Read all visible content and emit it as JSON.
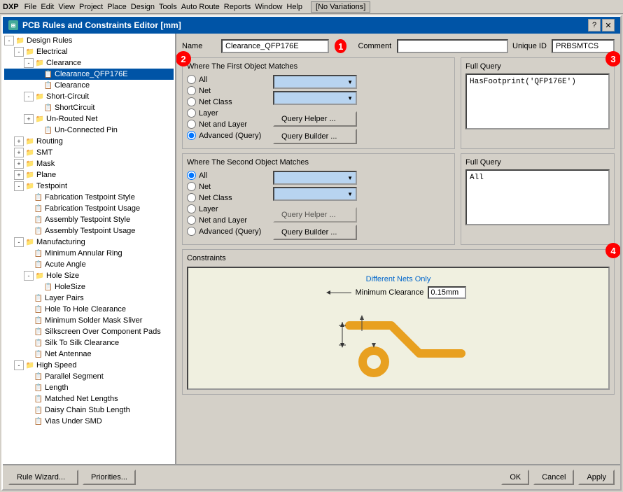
{
  "app": {
    "title": "PCB Rules and Constraints Editor [mm]",
    "help_btn": "?",
    "close_btn": "✕"
  },
  "menubar": {
    "items": [
      "DXP",
      "File",
      "Edit",
      "View",
      "Project",
      "Place",
      "Design",
      "Tools",
      "Auto Route",
      "Reports",
      "Window",
      "Help"
    ]
  },
  "topbar": {
    "variation": "[No Variations]"
  },
  "tree": {
    "root": "Design Rules",
    "items": [
      {
        "id": "design-rules",
        "label": "Design Rules",
        "level": 0,
        "expanded": true,
        "icon": "folder"
      },
      {
        "id": "electrical",
        "label": "Electrical",
        "level": 1,
        "expanded": true,
        "icon": "folder"
      },
      {
        "id": "clearance",
        "label": "Clearance",
        "level": 2,
        "expanded": true,
        "icon": "folder"
      },
      {
        "id": "clearance-qfp176e",
        "label": "Clearance_QFP176E",
        "level": 3,
        "expanded": false,
        "icon": "rule",
        "selected": true
      },
      {
        "id": "clearance-leaf",
        "label": "Clearance",
        "level": 3,
        "expanded": false,
        "icon": "rule"
      },
      {
        "id": "short-circuit",
        "label": "Short-Circuit",
        "level": 2,
        "expanded": true,
        "icon": "folder"
      },
      {
        "id": "shortcircuit-leaf",
        "label": "ShortCircuit",
        "level": 3,
        "expanded": false,
        "icon": "rule"
      },
      {
        "id": "un-routed-net",
        "label": "Un-Routed Net",
        "level": 2,
        "expanded": false,
        "icon": "folder"
      },
      {
        "id": "un-connected-pin",
        "label": "Un-Connected Pin",
        "level": 2,
        "expanded": false,
        "icon": "rule"
      },
      {
        "id": "routing",
        "label": "Routing",
        "level": 1,
        "expanded": false,
        "icon": "folder"
      },
      {
        "id": "smt",
        "label": "SMT",
        "level": 1,
        "expanded": false,
        "icon": "folder"
      },
      {
        "id": "mask",
        "label": "Mask",
        "level": 1,
        "expanded": false,
        "icon": "folder"
      },
      {
        "id": "plane",
        "label": "Plane",
        "level": 1,
        "expanded": false,
        "icon": "folder"
      },
      {
        "id": "testpoint",
        "label": "Testpoint",
        "level": 1,
        "expanded": true,
        "icon": "folder"
      },
      {
        "id": "fab-testpoint-style",
        "label": "Fabrication Testpoint Style",
        "level": 2,
        "expanded": false,
        "icon": "rule"
      },
      {
        "id": "fab-testpoint-usage",
        "label": "Fabrication Testpoint Usage",
        "level": 2,
        "expanded": false,
        "icon": "rule"
      },
      {
        "id": "asm-testpoint-style",
        "label": "Assembly Testpoint Style",
        "level": 2,
        "expanded": false,
        "icon": "rule"
      },
      {
        "id": "asm-testpoint-usage",
        "label": "Assembly Testpoint Usage",
        "level": 2,
        "expanded": false,
        "icon": "rule"
      },
      {
        "id": "manufacturing",
        "label": "Manufacturing",
        "level": 1,
        "expanded": true,
        "icon": "folder"
      },
      {
        "id": "min-annular-ring",
        "label": "Minimum Annular Ring",
        "level": 2,
        "expanded": false,
        "icon": "rule"
      },
      {
        "id": "acute-angle",
        "label": "Acute Angle",
        "level": 2,
        "expanded": false,
        "icon": "rule"
      },
      {
        "id": "hole-size",
        "label": "Hole Size",
        "level": 2,
        "expanded": true,
        "icon": "folder"
      },
      {
        "id": "holesize-leaf",
        "label": "HoleSize",
        "level": 3,
        "expanded": false,
        "icon": "rule"
      },
      {
        "id": "layer-pairs",
        "label": "Layer Pairs",
        "level": 2,
        "expanded": false,
        "icon": "rule"
      },
      {
        "id": "hole-to-hole",
        "label": "Hole To Hole Clearance",
        "level": 2,
        "expanded": false,
        "icon": "rule"
      },
      {
        "id": "min-solder-mask",
        "label": "Minimum Solder Mask Sliver",
        "level": 2,
        "expanded": false,
        "icon": "rule"
      },
      {
        "id": "silkscreen-over",
        "label": "Silkscreen Over Component Pads",
        "level": 2,
        "expanded": false,
        "icon": "rule"
      },
      {
        "id": "silk-to-silk",
        "label": "Silk To Silk Clearance",
        "level": 2,
        "expanded": false,
        "icon": "rule"
      },
      {
        "id": "net-antennae",
        "label": "Net Antennae",
        "level": 2,
        "expanded": false,
        "icon": "rule"
      },
      {
        "id": "high-speed",
        "label": "High Speed",
        "level": 1,
        "expanded": true,
        "icon": "folder"
      },
      {
        "id": "parallel-segment",
        "label": "Parallel Segment",
        "level": 2,
        "expanded": false,
        "icon": "rule"
      },
      {
        "id": "length",
        "label": "Length",
        "level": 2,
        "expanded": false,
        "icon": "rule"
      },
      {
        "id": "matched-net-lengths",
        "label": "Matched Net Lengths",
        "level": 2,
        "expanded": false,
        "icon": "rule"
      },
      {
        "id": "daisy-chain",
        "label": "Daisy Chain Stub Length",
        "level": 2,
        "expanded": false,
        "icon": "rule"
      },
      {
        "id": "vias-under-smd",
        "label": "Vias Under SMD",
        "level": 2,
        "expanded": false,
        "icon": "rule"
      }
    ]
  },
  "editor": {
    "name_label": "Name",
    "name_value": "Clearance_QFP176E",
    "comment_label": "Comment",
    "comment_value": "",
    "unique_id_label": "Unique ID",
    "unique_id_value": "PRBSMTCS",
    "num_badge_1": "1",
    "first_object": {
      "title": "Where The First Object Matches",
      "options": [
        "All",
        "Net",
        "Net Class",
        "Layer",
        "Net and Layer",
        "Advanced (Query)"
      ],
      "selected": "Advanced (Query)",
      "query_helper_btn": "Query Helper ...",
      "query_builder_btn": "Query Builder ...",
      "full_query_label": "Full Query",
      "full_query_value": "HasFootprint('QFP176E')",
      "num_badge": "2",
      "num_badge_3": "3"
    },
    "second_object": {
      "title": "Where The Second Object Matches",
      "options": [
        "All",
        "Net",
        "Net Class",
        "Layer",
        "Net and Layer",
        "Advanced (Query)"
      ],
      "selected": "All",
      "query_helper_btn": "Query Helper ...",
      "query_builder_btn": "Query Builder ...",
      "full_query_label": "Full Query",
      "full_query_value": "All"
    },
    "constraints": {
      "title": "Constraints",
      "different_nets_label": "Different Nets Only",
      "min_clearance_label": "Minimum Clearance",
      "min_clearance_value": "0.15mm",
      "num_badge_4": "4"
    }
  },
  "bottom": {
    "rule_wizard_btn": "Rule Wizard...",
    "priorities_btn": "Priorities...",
    "ok_btn": "OK",
    "cancel_btn": "Cancel",
    "apply_btn": "Apply"
  }
}
